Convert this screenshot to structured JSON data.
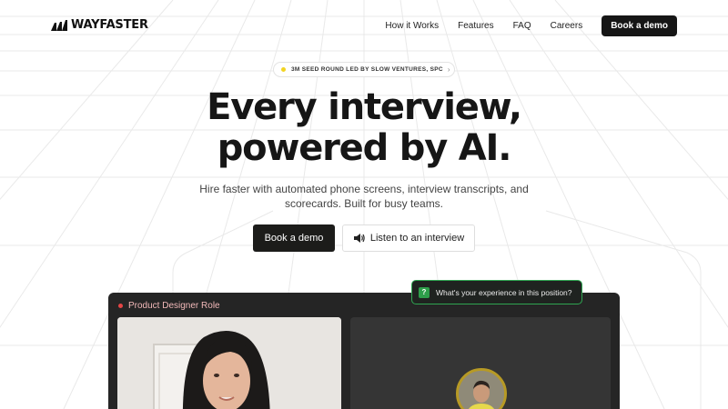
{
  "brand": {
    "name": "WAYFASTER",
    "logo_icon": "wayfaster-logo-mark-icon"
  },
  "nav": {
    "links": [
      "How it Works",
      "Features",
      "FAQ",
      "Careers"
    ],
    "cta": "Book a demo"
  },
  "badge": {
    "text": "3M SEED ROUND LED BY SLOW VENTURES, SPC",
    "icon": "chevron-right-icon"
  },
  "hero": {
    "headline_line1": "Every interview,",
    "headline_line2": "powered by AI.",
    "sub_line1": "Hire faster with automated phone screens, interview transcripts, and",
    "sub_line2": "scorecards. Built for busy teams."
  },
  "buttons": {
    "primary": "Book a demo",
    "secondary": "Listen to an interview",
    "secondary_icon": "speaker-icon"
  },
  "demo": {
    "title": "Product Designer Role",
    "question_icon": "?",
    "question": "What's your experience in this position?"
  },
  "colors": {
    "accent_dark": "#1c1c1a",
    "badge_dot": "#f2d422",
    "record_dot": "#e54545",
    "question_border": "#2fa451"
  }
}
